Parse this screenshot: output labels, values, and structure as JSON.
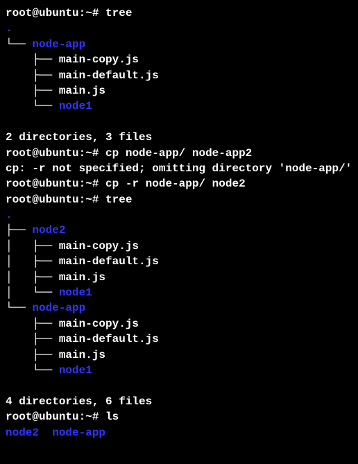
{
  "prompt": {
    "user": "root@ubuntu",
    "separator": ":",
    "path": "~",
    "symbol": "# "
  },
  "commands": {
    "cmd1": "tree",
    "cmd2": "cp node-app/ node-app2",
    "cmd3": "cp -r node-app/ node2",
    "cmd4": "tree",
    "cmd5": "ls"
  },
  "tree1": {
    "dot": ".",
    "dir1": "node-app",
    "file1": "main-copy.js",
    "file2": "main-default.js",
    "file3": "main.js",
    "dir2": "node1",
    "summary": "2 directories, 3 files"
  },
  "error1": "cp: -r not specified; omitting directory 'node-app/'",
  "tree2": {
    "dot": ".",
    "dir1": "node2",
    "file1": "main-copy.js",
    "file2": "main-default.js",
    "file3": "main.js",
    "dir2": "node1",
    "dir3": "node-app",
    "file4": "main-copy.js",
    "file5": "main-default.js",
    "file6": "main.js",
    "dir4": "node1",
    "summary": "4 directories, 6 files"
  },
  "ls_output": {
    "item1": "node2",
    "item2": "node-app"
  },
  "tree_chars": {
    "last": "└── ",
    "mid": "├── ",
    "pipe": "│   ",
    "space": "    "
  }
}
